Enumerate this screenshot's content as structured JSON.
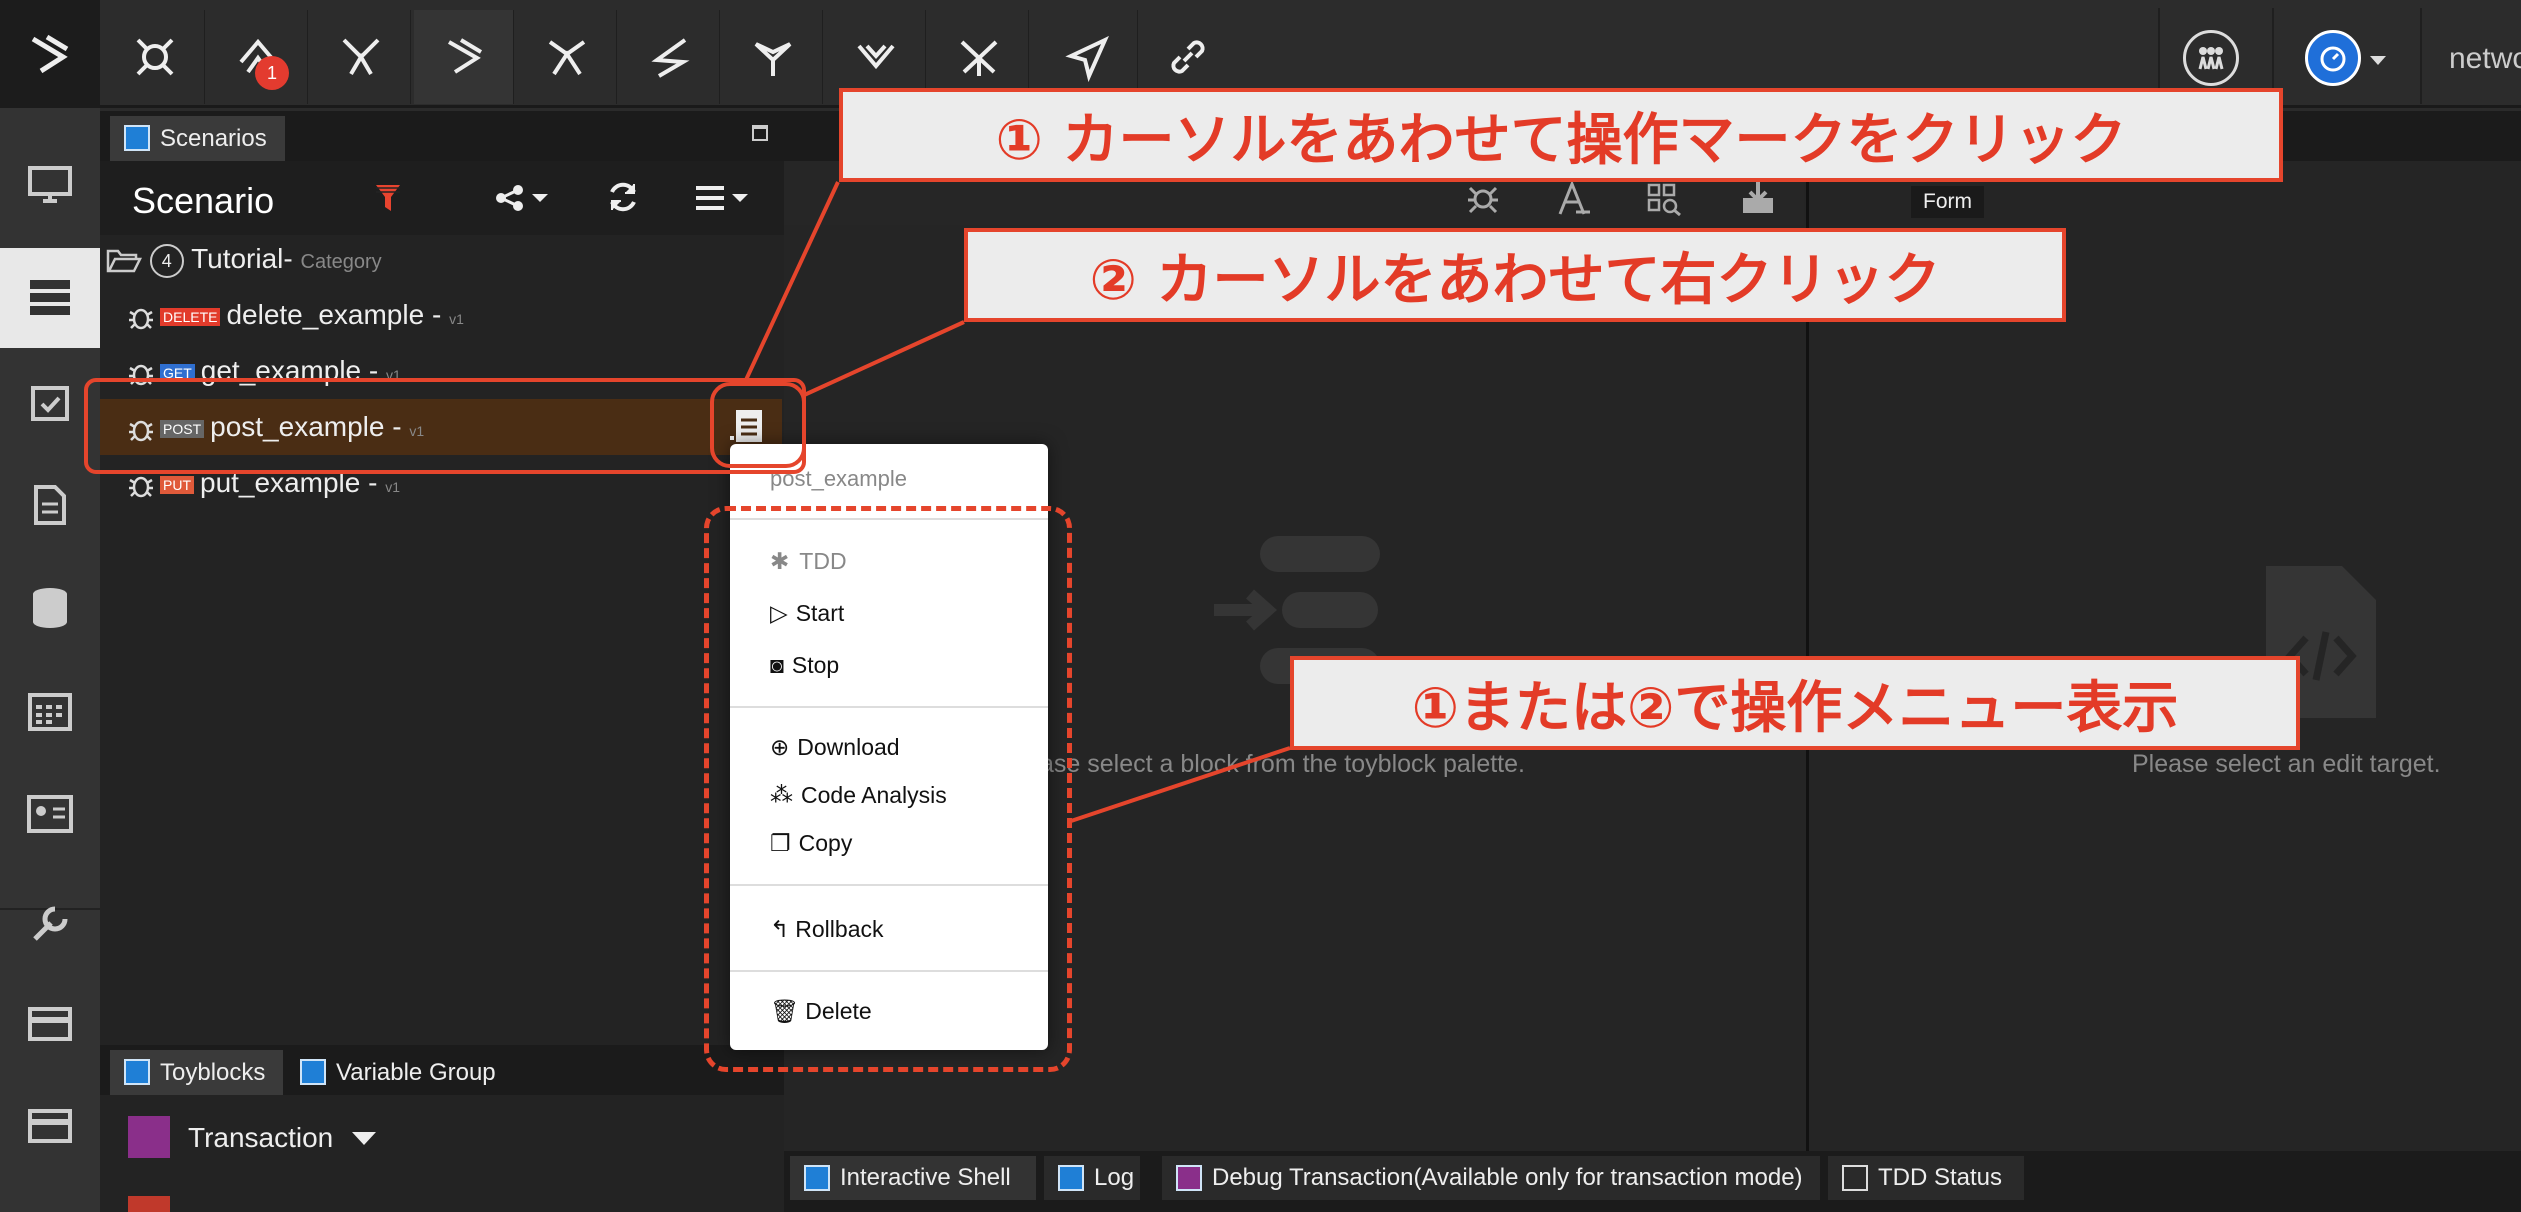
{
  "topbar": {
    "badge_count": "1",
    "network_label": "netwo",
    "icons": [
      "app-logo-icon",
      "toyblock-icon-1",
      "toyblock-icon-2",
      "toyblock-icon-3",
      "toyblock-icon-4",
      "toyblock-icon-5",
      "toyblock-icon-6",
      "toyblock-icon-7",
      "toyblock-icon-8",
      "toyblock-icon-9",
      "send-icon",
      "link-icon"
    ]
  },
  "scenarios_panel": {
    "tab_label": "Scenarios",
    "title": "Scenario",
    "category": {
      "count": "4",
      "name": "Tutorial-",
      "suffix": "Category"
    },
    "items": [
      {
        "method": "DELETE",
        "name": "delete_example -",
        "version": "v1",
        "method_color": "#e23b2b"
      },
      {
        "method": "GET",
        "name": "get_example -",
        "version": "v1",
        "method_color": "#2f6fd0"
      },
      {
        "method": "POST",
        "name": "post_example -",
        "version": "v1",
        "method_color": "#666666"
      },
      {
        "method": "PUT",
        "name": "put_example -",
        "version": "v1",
        "method_color": "#e05a3a"
      }
    ]
  },
  "editor_panel": {
    "form_label": "Form",
    "palette_hint": "ase select a block from the toyblock palette.",
    "edit_hint": "Please select an edit target."
  },
  "context_menu": {
    "header": "post_example",
    "items": {
      "tdd": "TDD",
      "start": "Start",
      "stop": "Stop",
      "download": "Download",
      "code_analysis": "Code Analysis",
      "copy": "Copy",
      "rollback": "Rollback",
      "delete": "Delete"
    }
  },
  "bottom_left": {
    "tabs": [
      "Toyblocks",
      "Variable Group"
    ],
    "group": "Transaction"
  },
  "bottom_tabs": [
    "Interactive Shell",
    "Log",
    "Debug Transaction(Available only for transaction mode)",
    "TDD Status"
  ],
  "annotations": {
    "step1": "① カーソルをあわせて操作マークをクリック",
    "step2": "② カーソルをあわせて右クリック",
    "result": "①または②で操作メニュー表示"
  },
  "colors": {
    "accent_red": "#e5452c",
    "filter_red": "#e8442f",
    "highlight_row": "#4a2d14"
  }
}
